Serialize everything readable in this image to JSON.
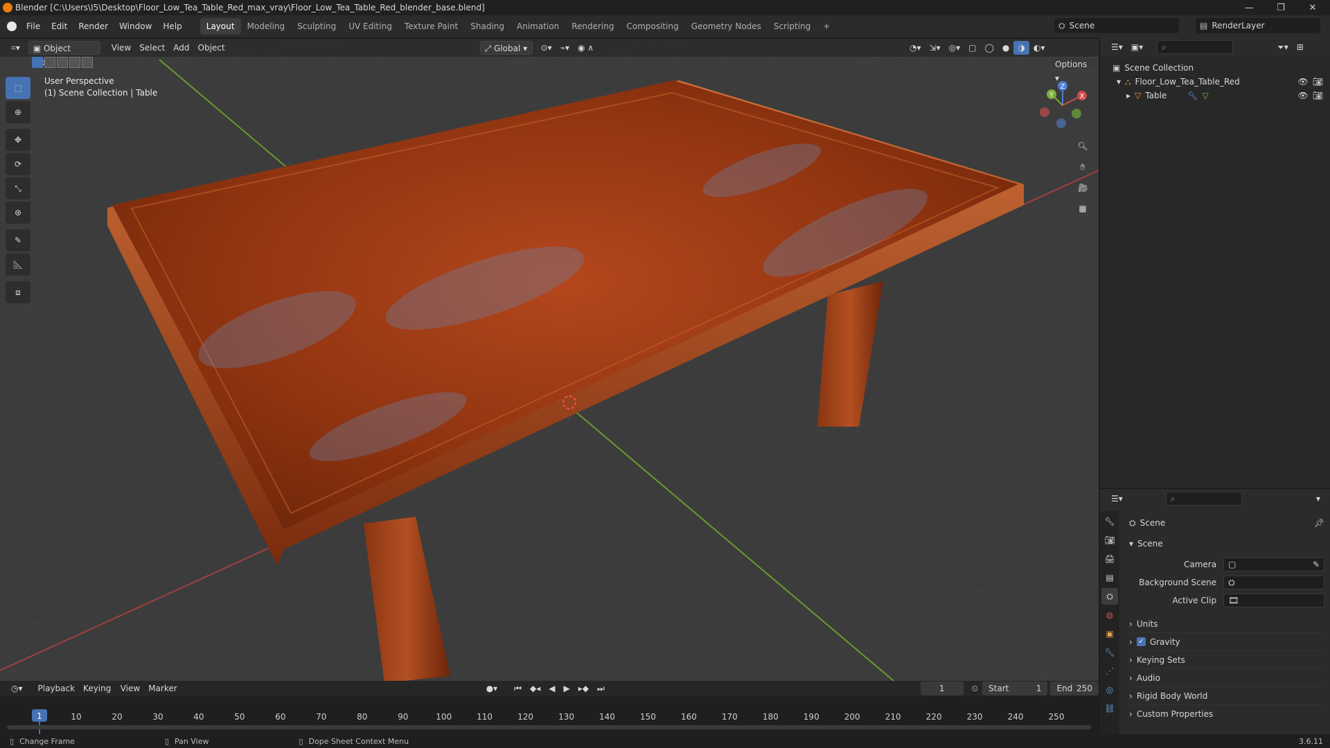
{
  "window": {
    "title": "Blender [C:\\Users\\I5\\Desktop\\Floor_Low_Tea_Table_Red_max_vray\\Floor_Low_Tea_Table_Red_blender_base.blend]"
  },
  "menu": {
    "items": [
      "File",
      "Edit",
      "Render",
      "Window",
      "Help"
    ],
    "workspaces": [
      "Layout",
      "Modeling",
      "Sculpting",
      "UV Editing",
      "Texture Paint",
      "Shading",
      "Animation",
      "Rendering",
      "Compositing",
      "Geometry Nodes",
      "Scripting"
    ],
    "active_workspace": "Layout",
    "scene": "Scene",
    "render_layer": "RenderLayer"
  },
  "viewport_header": {
    "mode": "Object Mode",
    "menus": [
      "View",
      "Select",
      "Add",
      "Object"
    ],
    "orientation": "Global",
    "options": "Options"
  },
  "viewport": {
    "perspective": "User Perspective",
    "collection_info": "(1) Scene Collection | Table",
    "gizmo": {
      "z": "Z",
      "y": "Y",
      "x": "X"
    }
  },
  "outliner": {
    "root": "Scene Collection",
    "collection": "Floor_Low_Tea_Table_Red",
    "object": "Table"
  },
  "properties": {
    "context": "Scene",
    "panel": "Scene",
    "fields": {
      "camera": "Camera",
      "background_scene": "Background Scene",
      "active_clip": "Active Clip"
    },
    "sections": [
      "Units",
      "Gravity",
      "Keying Sets",
      "Audio",
      "Rigid Body World",
      "Custom Properties"
    ],
    "gravity_checked": true
  },
  "timeline": {
    "menus": [
      "Playback",
      "Keying",
      "View",
      "Marker"
    ],
    "current_frame": "1",
    "start_label": "Start",
    "start": "1",
    "end_label": "End",
    "end": "250",
    "ticks": [
      "1",
      "10",
      "20",
      "30",
      "40",
      "50",
      "60",
      "70",
      "80",
      "90",
      "100",
      "110",
      "120",
      "130",
      "140",
      "150",
      "160",
      "170",
      "180",
      "190",
      "200",
      "210",
      "220",
      "230",
      "240",
      "250"
    ]
  },
  "status": {
    "left": "Change Frame",
    "middle": "Pan View",
    "right": "Dope Sheet Context Menu",
    "version": "3.6.11"
  },
  "colors": {
    "accent": "#4772b3",
    "x_axis": "#d04a4a",
    "y_axis": "#8cc63f",
    "wood": "#a8431c"
  }
}
